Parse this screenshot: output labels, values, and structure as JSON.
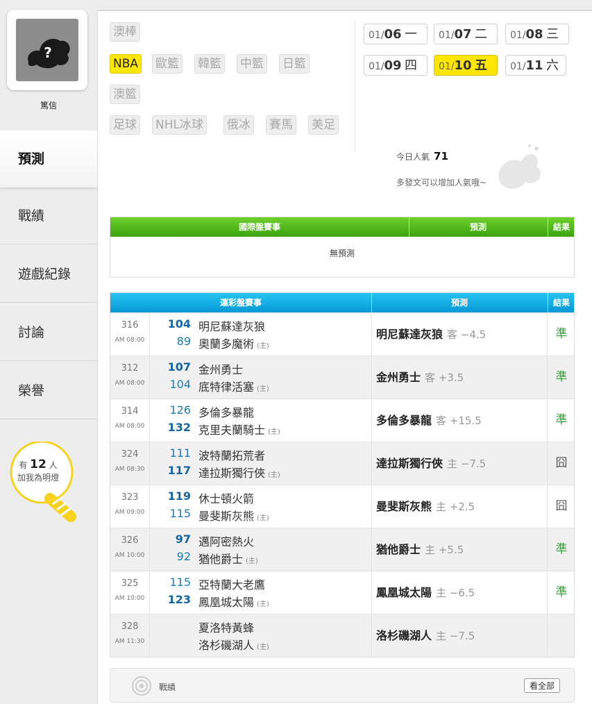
{
  "sidebar": {
    "username": "篤信",
    "nav": [
      "預測",
      "戰績",
      "遊戲紀錄",
      "討論",
      "榮譽"
    ],
    "fans_prefix": "有",
    "fans_count": "12",
    "fans_suffix": "人",
    "fans_line2": "加我為明燈"
  },
  "sports_tags": [
    "澳棒",
    "NBA",
    "歐籃",
    "韓籃",
    "中籃",
    "日籃",
    "澳籃",
    "足球",
    "NHL冰球",
    "俄冰",
    "賽馬",
    "美足"
  ],
  "selected_tag": "NBA",
  "dates": [
    {
      "md": "01/",
      "d": "06",
      "wd": "一"
    },
    {
      "md": "01/",
      "d": "07",
      "wd": "二"
    },
    {
      "md": "01/",
      "d": "08",
      "wd": "三"
    },
    {
      "md": "01/",
      "d": "09",
      "wd": "四"
    },
    {
      "md": "01/",
      "d": "10",
      "wd": "五"
    },
    {
      "md": "01/",
      "d": "11",
      "wd": "六"
    }
  ],
  "selected_date": "10",
  "popularity": {
    "label": "今日人氣",
    "value": "71",
    "hint": "多發文可以增加人氣哦~"
  },
  "intl_table": {
    "h_match": "國際盤賽事",
    "h_pred": "預測",
    "h_result": "結果",
    "empty": "無預測"
  },
  "lottery_table": {
    "h_match": "運彩盤賽事",
    "h_pred": "預測",
    "h_result": "結果",
    "home_tag": "(主)",
    "rows": [
      {
        "num": "316",
        "time": "AM 08:00",
        "s1": "104",
        "t1": "明尼蘇達灰狼",
        "s2": "89",
        "t2": "奧蘭多魔術",
        "win": 1,
        "pred": "明尼蘇達灰狼",
        "pred_note": "客 −4.5",
        "result": "準"
      },
      {
        "num": "312",
        "time": "AM 08:00",
        "s1": "107",
        "t1": "金州勇士",
        "s2": "104",
        "t2": "底特律活塞",
        "win": 1,
        "pred": "金州勇士",
        "pred_note": "客 +3.5",
        "result": "準"
      },
      {
        "num": "314",
        "time": "AM 08:00",
        "s1": "126",
        "t1": "多倫多暴龍",
        "s2": "132",
        "t2": "克里夫蘭騎士",
        "win": 2,
        "pred": "多倫多暴龍",
        "pred_note": "客 +15.5",
        "result": "準"
      },
      {
        "num": "324",
        "time": "AM 08:30",
        "s1": "111",
        "t1": "波特蘭拓荒者",
        "s2": "117",
        "t2": "達拉斯獨行俠",
        "win": 2,
        "pred": "達拉斯獨行俠",
        "pred_note": "主 −7.5",
        "result": "囧"
      },
      {
        "num": "323",
        "time": "AM 09:00",
        "s1": "119",
        "t1": "休士頓火箭",
        "s2": "115",
        "t2": "曼斐斯灰熊",
        "win": 1,
        "pred": "曼斐斯灰熊",
        "pred_note": "主 +2.5",
        "result": "囧"
      },
      {
        "num": "326",
        "time": "AM 10:00",
        "s1": "97",
        "t1": "邁阿密熱火",
        "s2": "92",
        "t2": "猶他爵士",
        "win": 1,
        "pred": "猶他爵士",
        "pred_note": "主 +5.5",
        "result": "準"
      },
      {
        "num": "325",
        "time": "AM 10:00",
        "s1": "115",
        "t1": "亞特蘭大老鷹",
        "s2": "123",
        "t2": "鳳凰城太陽",
        "win": 2,
        "pred": "鳳凰城太陽",
        "pred_note": "主 −6.5",
        "result": "準"
      },
      {
        "num": "328",
        "time": "AM 11:30",
        "s1": "",
        "t1": "夏洛特黃蜂",
        "s2": "",
        "t2": "洛杉磯湖人",
        "win": 0,
        "pred": "洛杉磯湖人",
        "pred_note": "主 −7.5",
        "result": ""
      }
    ]
  },
  "record_bar": {
    "label": "戰績",
    "see_all": "看全部"
  },
  "colors": {
    "accent_yellow": "#ffe600",
    "header_green": "#4ab51a",
    "header_blue": "#0aa5e0",
    "ok_green": "#33a033",
    "score_blue": "#1565a3"
  }
}
